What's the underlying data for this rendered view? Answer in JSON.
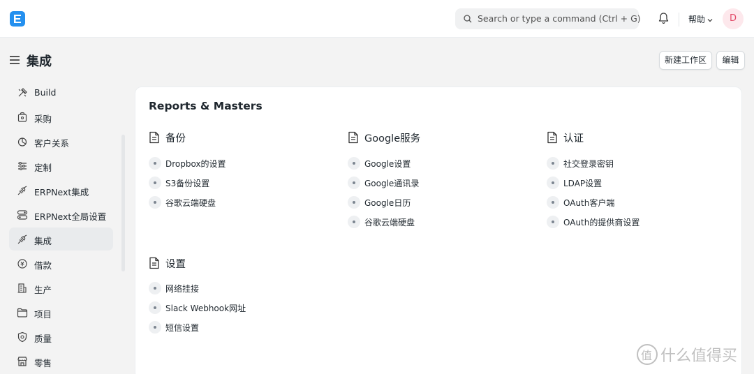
{
  "navbar": {
    "logo_letter": "E",
    "search_placeholder": "Search or type a command (Ctrl + G)",
    "help_label": "帮助",
    "avatar_initial": "D"
  },
  "header": {
    "title": "集成",
    "new_workspace_label": "新建工作区",
    "edit_label": "编辑"
  },
  "sidebar": {
    "items": [
      {
        "label": "Build",
        "icon": "tools-icon"
      },
      {
        "label": "采购",
        "icon": "purchase-icon"
      },
      {
        "label": "客户关系",
        "icon": "crm-icon"
      },
      {
        "label": "定制",
        "icon": "customize-icon"
      },
      {
        "label": "ERPNext集成",
        "icon": "integration-icon"
      },
      {
        "label": "ERPNext全局设置",
        "icon": "settings-toggle-icon"
      },
      {
        "label": "集成",
        "icon": "integration-icon",
        "active": true
      },
      {
        "label": "借款",
        "icon": "loan-icon"
      },
      {
        "label": "生产",
        "icon": "building-icon"
      },
      {
        "label": "项目",
        "icon": "folder-icon"
      },
      {
        "label": "质量",
        "icon": "shield-icon"
      },
      {
        "label": "零售",
        "icon": "store-icon"
      }
    ]
  },
  "main": {
    "card_title": "Reports & Masters",
    "sections": [
      {
        "title": "备份",
        "links": [
          "Dropbox的设置",
          "S3备份设置",
          "谷歌云端硬盘"
        ]
      },
      {
        "title": "Google服务",
        "links": [
          "Google设置",
          "Google通讯录",
          "Google日历",
          "谷歌云端硬盘"
        ]
      },
      {
        "title": "认证",
        "links": [
          "社交登录密钥",
          "LDAP设置",
          "OAuth客户端",
          "OAuth的提供商设置"
        ]
      },
      {
        "title": "设置",
        "links": [
          "网络挂接",
          "Slack Webhook网址",
          "短信设置"
        ]
      }
    ]
  },
  "watermark": {
    "text": "什么值得买",
    "logo_glyph": "值"
  },
  "colors": {
    "accent": "#2490ef",
    "active_bg": "#e9ebed",
    "avatar_bg": "#fde8ec"
  }
}
